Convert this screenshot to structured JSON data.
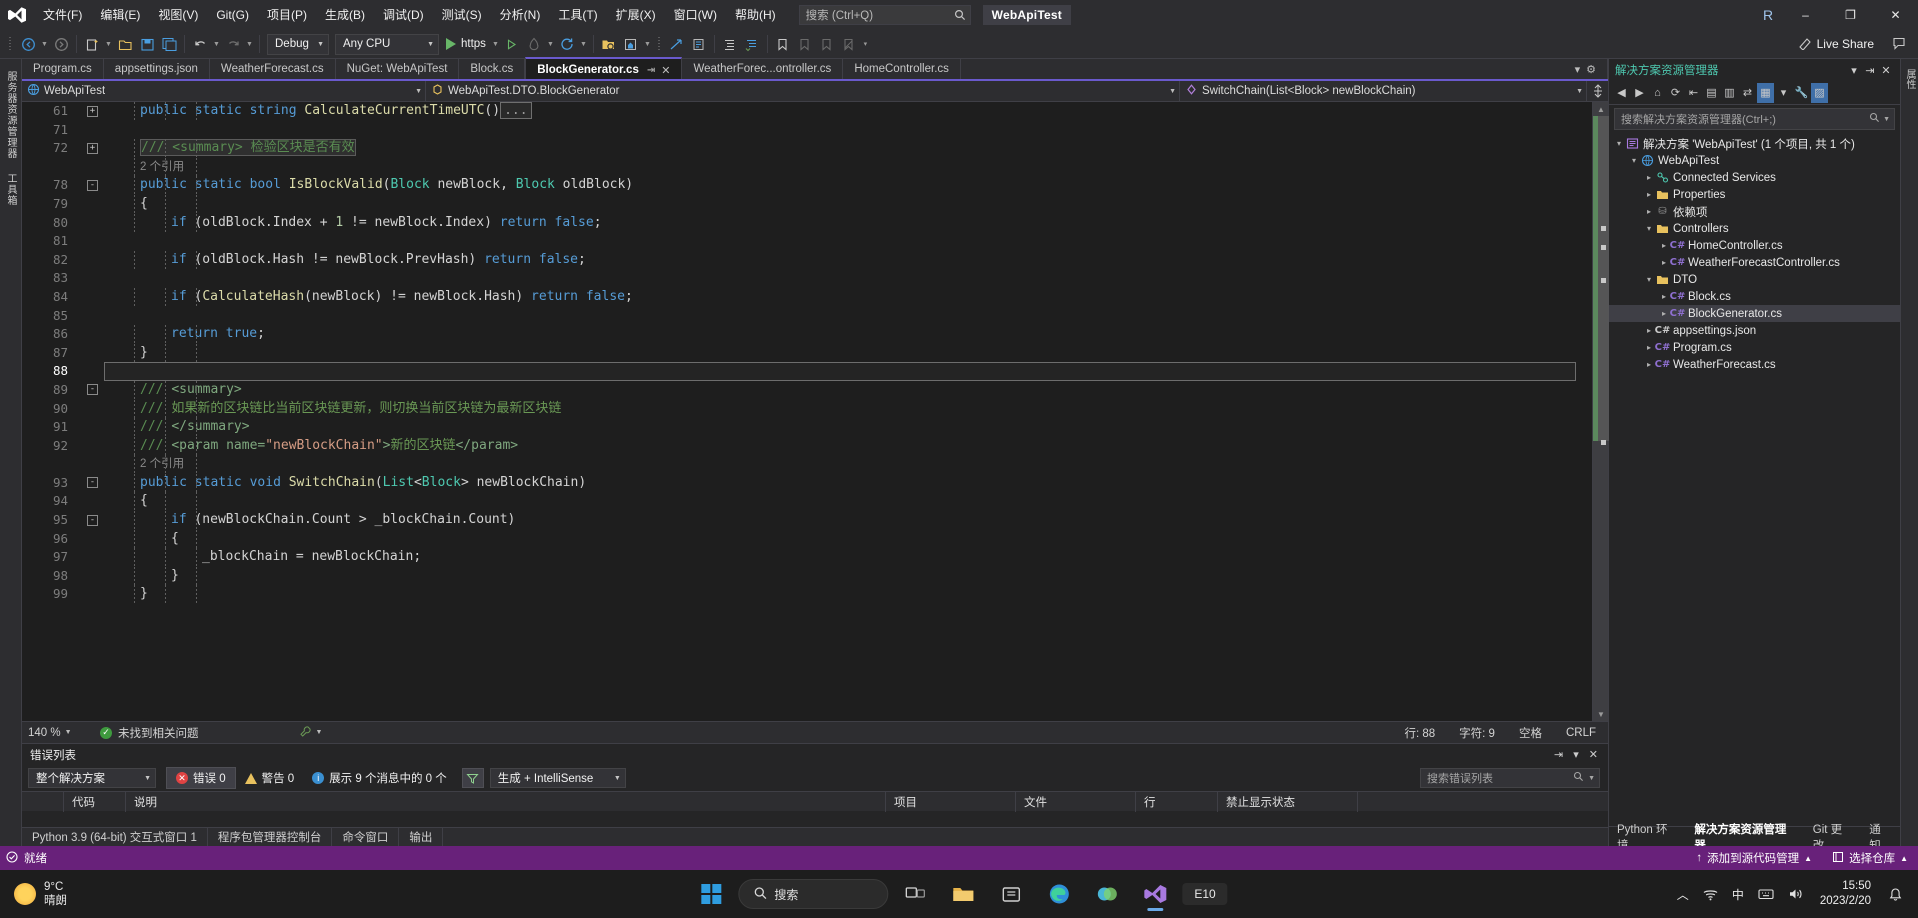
{
  "titlebar": {
    "logo_icon": "visual-studio-logo",
    "menus": [
      {
        "label": "文件(F)"
      },
      {
        "label": "编辑(E)"
      },
      {
        "label": "视图(V)"
      },
      {
        "label": "Git(G)"
      },
      {
        "label": "项目(P)"
      },
      {
        "label": "生成(B)"
      },
      {
        "label": "调试(D)"
      },
      {
        "label": "测试(S)"
      },
      {
        "label": "分析(N)"
      },
      {
        "label": "工具(T)"
      },
      {
        "label": "扩展(X)"
      },
      {
        "label": "窗口(W)"
      },
      {
        "label": "帮助(H)"
      }
    ],
    "search_placeholder": "搜索 (Ctrl+Q)",
    "search_icon": "search-icon",
    "project_chip": "WebApiTest",
    "account_initial": "R",
    "minimize": "–",
    "restore": "❐",
    "close": "✕"
  },
  "toolbar": {
    "nav_back_icon": "navigate-back-icon",
    "nav_forward_icon": "navigate-forward-icon",
    "new_project_icon": "new-project-icon",
    "open_file_icon": "open-file-icon",
    "save_icon": "save-icon",
    "save_all_icon": "save-all-icon",
    "undo_icon": "undo-icon",
    "redo_icon": "redo-icon",
    "config_value": "Debug",
    "platform_value": "Any CPU",
    "run_label": "https",
    "run_icon": "play-icon",
    "run_no_debug_icon": "play-outline-icon",
    "hot_reload_icon": "hot-reload-icon",
    "refresh_icon": "restart-icon",
    "folder_search_icon": "folder-search-icon",
    "home_icon": "home-icon",
    "step_icon": "step-into-icon",
    "list_icon": "list-icon",
    "indent_icon": "indent-icon",
    "comment_icon": "comment-icon",
    "bookmark_icon": "bookmark-icon",
    "bookmark_prev_icon": "bookmark-prev-icon",
    "bookmark_next_icon": "bookmark-next-icon",
    "bookmark_clear_icon": "bookmark-clear-icon",
    "live_share_label": "Live Share",
    "live_share_icon": "live-share-icon",
    "feedback_icon": "feedback-icon"
  },
  "left_rail": {
    "items": [
      {
        "label": "服务器资源管理器",
        "icon": "server-explorer-icon"
      },
      {
        "label": "工具箱",
        "icon": "toolbox-icon"
      }
    ]
  },
  "tabs": [
    {
      "label": "Program.cs",
      "active": false
    },
    {
      "label": "appsettings.json",
      "active": false
    },
    {
      "label": "WeatherForecast.cs",
      "active": false
    },
    {
      "label": "NuGet: WebApiTest",
      "active": false
    },
    {
      "label": "Block.cs",
      "active": false
    },
    {
      "label": "BlockGenerator.cs",
      "active": true,
      "pin_icon": "pin-icon",
      "close_icon": "close-icon"
    },
    {
      "label": "WeatherForec...ontroller.cs",
      "active": false
    },
    {
      "label": "HomeController.cs",
      "active": false
    }
  ],
  "navbar": {
    "project": "WebApiTest",
    "project_icon": "project-icon",
    "type": "WebApiTest.DTO.BlockGenerator",
    "type_icon": "class-icon",
    "member": "SwitchChain(List<Block> newBlockChain)",
    "member_icon": "method-icon",
    "split_icon": "split-editor-icon",
    "dropdown_icon": "chevron-down-icon"
  },
  "editor": {
    "lines": [
      {
        "num": "61",
        "indent": 0,
        "outline": "+",
        "change": true,
        "tokens": [
          {
            "t": "public ",
            "c": "k"
          },
          {
            "t": "static ",
            "c": "k"
          },
          {
            "t": "string ",
            "c": "k"
          },
          {
            "t": "CalculateCurrentTimeUTC",
            "c": "m"
          },
          {
            "t": "()",
            "c": "p"
          },
          {
            "t": "...",
            "c": "collapsed"
          }
        ]
      },
      {
        "num": "71",
        "indent": 0,
        "change": true,
        "tokens": []
      },
      {
        "num": "72",
        "indent": 0,
        "outline": "+",
        "change": true,
        "tokens": [
          {
            "t": "/// <summary> 检验区块是否有效",
            "c": "dochl"
          }
        ]
      },
      {
        "num": "",
        "indent": 0,
        "change": true,
        "codelens": "2 个引用"
      },
      {
        "num": "78",
        "indent": 0,
        "outline": "-",
        "change": true,
        "tokens": [
          {
            "t": "public ",
            "c": "k"
          },
          {
            "t": "static ",
            "c": "k"
          },
          {
            "t": "bool ",
            "c": "k"
          },
          {
            "t": "IsBlockValid",
            "c": "m"
          },
          {
            "t": "(",
            "c": "p"
          },
          {
            "t": "Block",
            "c": "t"
          },
          {
            "t": " newBlock, ",
            "c": "p"
          },
          {
            "t": "Block",
            "c": "t"
          },
          {
            "t": " oldBlock)",
            "c": "p"
          }
        ]
      },
      {
        "num": "79",
        "indent": 0,
        "change": true,
        "tokens": [
          {
            "t": "{",
            "c": "p"
          }
        ]
      },
      {
        "num": "80",
        "indent": 1,
        "change": true,
        "tokens": [
          {
            "t": "if ",
            "c": "k"
          },
          {
            "t": "(oldBlock.Index + ",
            "c": "p"
          },
          {
            "t": "1",
            "c": "n"
          },
          {
            "t": " != newBlock.Index) ",
            "c": "p"
          },
          {
            "t": "return ",
            "c": "k"
          },
          {
            "t": "false",
            "c": "k"
          },
          {
            "t": ";",
            "c": "p"
          }
        ]
      },
      {
        "num": "81",
        "indent": 1,
        "change": true,
        "tokens": []
      },
      {
        "num": "82",
        "indent": 1,
        "change": true,
        "tokens": [
          {
            "t": "if ",
            "c": "k"
          },
          {
            "t": "(oldBlock.Hash != newBlock.PrevHash) ",
            "c": "p"
          },
          {
            "t": "return ",
            "c": "k"
          },
          {
            "t": "false",
            "c": "k"
          },
          {
            "t": ";",
            "c": "p"
          }
        ]
      },
      {
        "num": "83",
        "indent": 1,
        "change": true,
        "tokens": []
      },
      {
        "num": "84",
        "indent": 1,
        "change": true,
        "tokens": [
          {
            "t": "if ",
            "c": "k"
          },
          {
            "t": "(",
            "c": "p"
          },
          {
            "t": "CalculateHash",
            "c": "m"
          },
          {
            "t": "(newBlock) != newBlock.Hash) ",
            "c": "p"
          },
          {
            "t": "return ",
            "c": "k"
          },
          {
            "t": "false",
            "c": "k"
          },
          {
            "t": ";",
            "c": "p"
          }
        ]
      },
      {
        "num": "85",
        "indent": 1,
        "change": true,
        "tokens": []
      },
      {
        "num": "86",
        "indent": 1,
        "change": true,
        "tokens": [
          {
            "t": "return ",
            "c": "k"
          },
          {
            "t": "true",
            "c": "k"
          },
          {
            "t": ";",
            "c": "p"
          }
        ]
      },
      {
        "num": "87",
        "indent": 0,
        "change": true,
        "tokens": [
          {
            "t": "}",
            "c": "p"
          }
        ]
      },
      {
        "num": "88",
        "indent": 0,
        "change": true,
        "current": true,
        "tokens": []
      },
      {
        "num": "89",
        "indent": 0,
        "outline": "-",
        "change": true,
        "tokens": [
          {
            "t": "/// ",
            "c": "cg"
          },
          {
            "t": "<summary>",
            "c": "xt"
          }
        ]
      },
      {
        "num": "90",
        "indent": 0,
        "change": true,
        "tokens": [
          {
            "t": "/// ",
            "c": "cg"
          },
          {
            "t": "如果新的区块链比当前区块链更新，则切换当前区块链为最新区块链",
            "c": "c"
          }
        ]
      },
      {
        "num": "91",
        "indent": 0,
        "change": true,
        "tokens": [
          {
            "t": "/// ",
            "c": "cg"
          },
          {
            "t": "</summary>",
            "c": "xt"
          }
        ]
      },
      {
        "num": "92",
        "indent": 0,
        "change": true,
        "tokens": [
          {
            "t": "/// ",
            "c": "cg"
          },
          {
            "t": "<param name=",
            "c": "xt"
          },
          {
            "t": "\"newBlockChain\"",
            "c": "s"
          },
          {
            "t": ">",
            "c": "xt"
          },
          {
            "t": "新的区块链",
            "c": "c"
          },
          {
            "t": "</param>",
            "c": "xt"
          }
        ]
      },
      {
        "num": "",
        "indent": 0,
        "change": true,
        "codelens": "2 个引用"
      },
      {
        "num": "93",
        "indent": 0,
        "outline": "-",
        "change": true,
        "tokens": [
          {
            "t": "public ",
            "c": "k"
          },
          {
            "t": "static ",
            "c": "k"
          },
          {
            "t": "void ",
            "c": "k"
          },
          {
            "t": "SwitchChain",
            "c": "m"
          },
          {
            "t": "(",
            "c": "p"
          },
          {
            "t": "List",
            "c": "t"
          },
          {
            "t": "<",
            "c": "p"
          },
          {
            "t": "Block",
            "c": "t"
          },
          {
            "t": "> newBlockChain)",
            "c": "p"
          }
        ]
      },
      {
        "num": "94",
        "indent": 0,
        "change": true,
        "tokens": [
          {
            "t": "{",
            "c": "p"
          }
        ]
      },
      {
        "num": "95",
        "indent": 1,
        "outline": "-",
        "change": true,
        "tokens": [
          {
            "t": "if ",
            "c": "k"
          },
          {
            "t": "(newBlockChain.Count > _blockChain.Count)",
            "c": "p"
          }
        ]
      },
      {
        "num": "96",
        "indent": 1,
        "change": true,
        "tokens": [
          {
            "t": "{",
            "c": "p"
          }
        ]
      },
      {
        "num": "97",
        "indent": 2,
        "change": true,
        "tokens": [
          {
            "t": "_blockChain = newBlockChain;",
            "c": "p"
          }
        ]
      },
      {
        "num": "98",
        "indent": 1,
        "change": true,
        "tokens": [
          {
            "t": "}",
            "c": "p"
          }
        ]
      },
      {
        "num": "99",
        "indent": 0,
        "change": true,
        "tokens": [
          {
            "t": "}",
            "c": "p"
          }
        ]
      }
    ]
  },
  "editor_status": {
    "zoom": "140 %",
    "issue_icon": "check-icon",
    "issue_text": "未找到相关问题",
    "wrench_icon": "wrench-icon",
    "line_label": "行: 88",
    "col_label": "字符: 9",
    "space_label": "空格",
    "eol_label": "CRLF"
  },
  "error_panel": {
    "title": "错误列表",
    "pin_icon": "pin-icon",
    "dropdown_icon": "chevron-down-icon",
    "close_icon": "close-icon",
    "scope_value": "整个解决方案",
    "errors_label": "错误 0",
    "warnings_label": "警告 0",
    "messages_label": "展示 9 个消息中的 0 个",
    "filter_icon": "filter-icon",
    "build_filter_value": "生成 + IntelliSense",
    "search_placeholder": "搜索错误列表",
    "search_icon": "search-icon",
    "columns": [
      "",
      "代码",
      "说明",
      "项目",
      "文件",
      "行",
      "禁止显示状态"
    ]
  },
  "bottom_tool_tabs": [
    {
      "label": "Python 3.9 (64-bit) 交互式窗口 1"
    },
    {
      "label": "程序包管理器控制台"
    },
    {
      "label": "命令窗口"
    },
    {
      "label": "输出"
    }
  ],
  "solution_explorer": {
    "title": "解决方案资源管理器",
    "dropdown_icon": "chevron-down-icon",
    "pin_icon": "pin-icon",
    "close_icon": "close-icon",
    "toolbar_icons": [
      "back-icon",
      "forward-icon",
      "home-icon",
      "refresh-icon",
      "collapse-all-icon",
      "show-all-files-icon",
      "properties-icon",
      "sync-icon",
      "filter-icon",
      "view-code-icon",
      "preview-icon",
      "properties-window-icon"
    ],
    "search_placeholder": "搜索解决方案资源管理器(Ctrl+;)",
    "search_icon": "search-icon",
    "tree": [
      {
        "depth": 0,
        "label": "解决方案 'WebApiTest' (1 个项目, 共 1 个)",
        "icon": "solution-icon",
        "expander": "▲",
        "selected": false
      },
      {
        "depth": 1,
        "label": "WebApiTest",
        "icon": "project-icon",
        "expander": "▲",
        "selected": false
      },
      {
        "depth": 2,
        "label": "Connected Services",
        "icon": "connected-services-icon",
        "expander": "▶",
        "selected": false
      },
      {
        "depth": 2,
        "label": "Properties",
        "icon": "folder-icon",
        "expander": "▶",
        "selected": false
      },
      {
        "depth": 2,
        "label": "依赖项",
        "icon": "dependencies-icon",
        "expander": "▶",
        "selected": false
      },
      {
        "depth": 2,
        "label": "Controllers",
        "icon": "folder-icon",
        "expander": "▲",
        "selected": false
      },
      {
        "depth": 3,
        "label": "HomeController.cs",
        "icon": "csharp-file-icon",
        "expander": "▶",
        "selected": false
      },
      {
        "depth": 3,
        "label": "WeatherForecastController.cs",
        "icon": "csharp-file-icon",
        "expander": "▶",
        "selected": false
      },
      {
        "depth": 2,
        "label": "DTO",
        "icon": "folder-icon",
        "expander": "▲",
        "selected": false
      },
      {
        "depth": 3,
        "label": "Block.cs",
        "icon": "csharp-file-icon",
        "expander": "▶",
        "selected": false
      },
      {
        "depth": 3,
        "label": "BlockGenerator.cs",
        "icon": "csharp-file-icon",
        "expander": "▶",
        "selected": true
      },
      {
        "depth": 2,
        "label": "appsettings.json",
        "icon": "json-file-icon",
        "expander": "▶",
        "selected": false
      },
      {
        "depth": 2,
        "label": "Program.cs",
        "icon": "csharp-file-icon",
        "expander": "▶",
        "selected": false
      },
      {
        "depth": 2,
        "label": "WeatherForecast.cs",
        "icon": "csharp-file-icon",
        "expander": "▶",
        "selected": false
      }
    ],
    "dock_tabs": [
      {
        "label": "Python 环境",
        "active": false
      },
      {
        "label": "解决方案资源管理器",
        "active": true
      },
      {
        "label": "Git 更改",
        "active": false
      },
      {
        "label": "通知",
        "active": false
      }
    ]
  },
  "far_rail": {
    "items": [
      {
        "label": "属性"
      }
    ]
  },
  "vs_status": {
    "ready_text": "就绪",
    "ready_icon": "ready-icon",
    "add_to_source_control": "添加到源代码管理",
    "add_icon": "upload-icon",
    "select_repo": "选择仓库",
    "repo_icon": "repository-icon",
    "chevron_icon": "chevron-up-icon"
  },
  "taskbar": {
    "weather_temp": "9°C",
    "weather_desc": "晴朗",
    "weather_icon": "sun-icon",
    "start_icon": "windows-start-icon",
    "search_label": "搜索",
    "search_icon": "search-icon",
    "taskview_icon": "task-view-icon",
    "explorer_icon": "file-explorer-icon",
    "store_icon": "microsoft-store-icon",
    "edge_icon": "edge-icon",
    "app_icon": "app-icon",
    "vs_icon": "visual-studio-icon",
    "pill_label": "E10",
    "tray_chevron_icon": "chevron-up-icon",
    "network_icon": "network-icon",
    "ime_label": "中",
    "keyboard_icon": "keyboard-icon",
    "volume_icon": "volume-icon",
    "time": "15:50",
    "date": "2023/2/20",
    "notification_icon": "notification-icon"
  },
  "colors": {
    "accent_purple": "#6a5acd",
    "status_purple": "#68217a",
    "change_green": "#58b558",
    "error_red": "#e04343",
    "warn_yellow": "#e8c15e",
    "info_blue": "#3a8fd0"
  }
}
